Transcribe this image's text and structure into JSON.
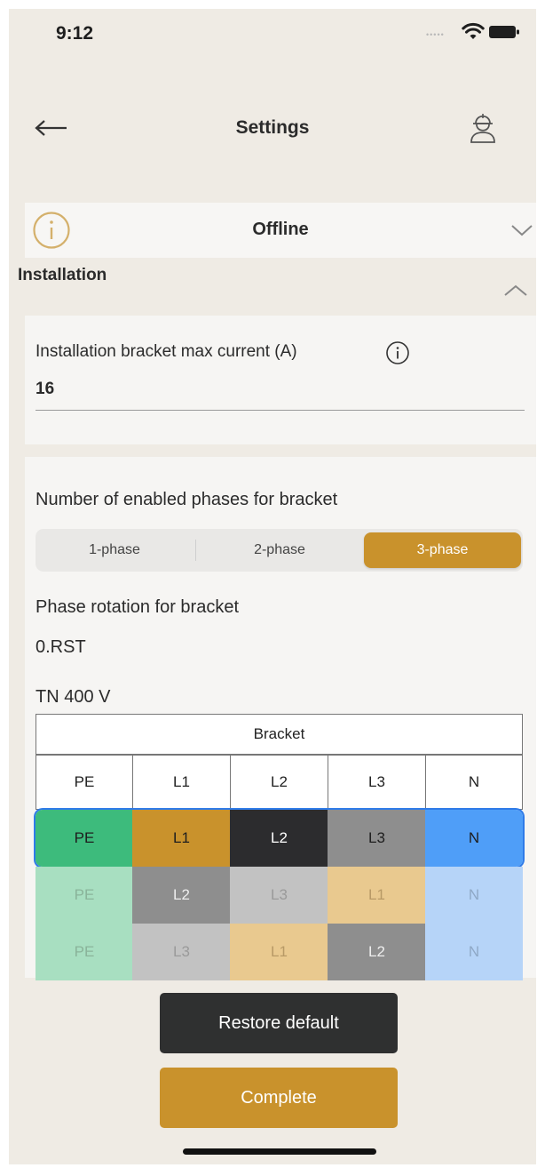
{
  "status_bar": {
    "time": "9:12"
  },
  "header": {
    "title": "Settings"
  },
  "banner": {
    "text": "Offline"
  },
  "section": {
    "label": "Installation"
  },
  "current_field": {
    "label": "Installation bracket max current (A)",
    "value": "16"
  },
  "phases": {
    "label": "Number of enabled phases for bracket",
    "options": [
      "1-phase",
      "2-phase",
      "3-phase"
    ],
    "selected": "3-phase"
  },
  "rotation": {
    "label": "Phase rotation for bracket",
    "value": "0.RST"
  },
  "table": {
    "network": "TN 400 V",
    "bracket_header": "Bracket",
    "columns": [
      "PE",
      "L1",
      "L2",
      "L3",
      "N"
    ],
    "rows": [
      [
        "PE",
        "L1",
        "L2",
        "L3",
        "N"
      ],
      [
        "PE",
        "L2",
        "L3",
        "L1",
        "N"
      ],
      [
        "PE",
        "L3",
        "L1",
        "L2",
        "N"
      ]
    ],
    "selected_row": 0
  },
  "colors": {
    "accent": "#c9922c",
    "pe": "#3dbb7c",
    "l1": "#c9922c",
    "l2": "#2c2c2e",
    "l3": "#8e8e8e",
    "n": "#4f9ef8",
    "selection_border": "#2f7be8"
  },
  "buttons": {
    "restore": "Restore default",
    "complete": "Complete"
  },
  "icons": {
    "back": "arrow-left-icon",
    "user": "technician-icon",
    "info": "info-icon",
    "expand": "chevron-down-icon",
    "collapse": "chevron-up-icon"
  }
}
